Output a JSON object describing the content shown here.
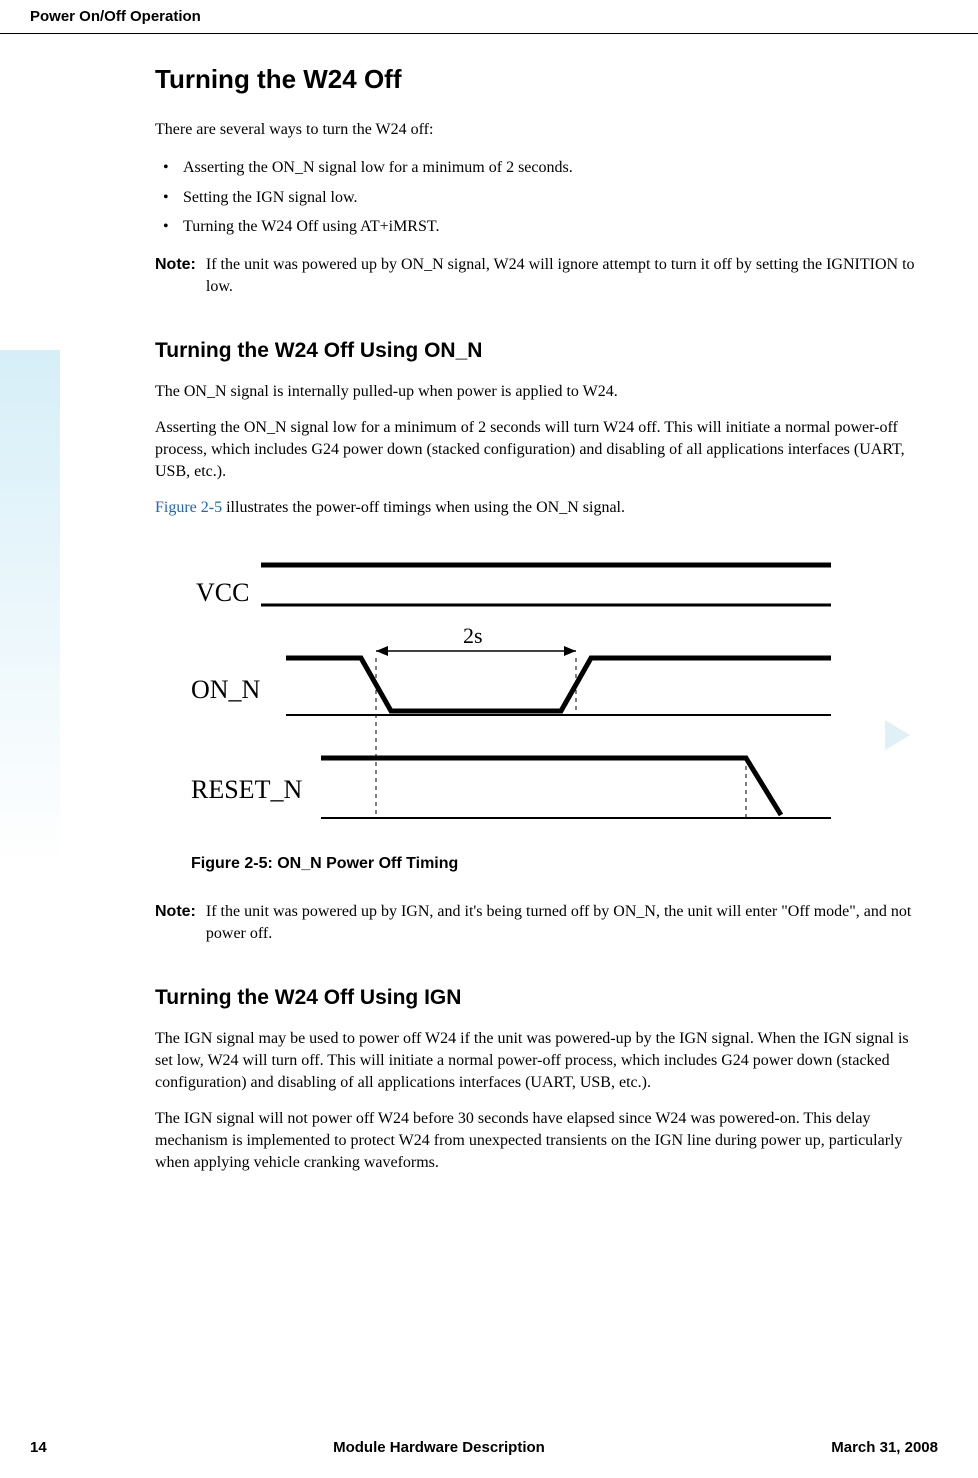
{
  "header": {
    "title": "Power On/Off Operation"
  },
  "section1": {
    "heading": "Turning the W24 Off",
    "intro": "There are several ways to turn the W24 off:",
    "bullets": [
      "Asserting the ON_N signal low for a minimum of 2 seconds.",
      "Setting the IGN signal low.",
      "Turning the W24 Off  using AT+iMRST."
    ],
    "note_label": "Note:",
    "note_text": "If the unit was powered up by ON_N signal, W24 will ignore attempt to turn it off by setting the IGNITION to low."
  },
  "section2": {
    "heading": "Turning the W24 Off Using ON_N",
    "para1": "The ON_N signal is internally pulled-up when power is applied to W24.",
    "para2": "Asserting the ON_N signal low for a minimum of 2 seconds will turn W24 off. This will initiate a normal power-off process, which includes G24 power down (stacked configuration) and disabling of all applications interfaces (UART, USB, etc.).",
    "figref": "Figure 2-5",
    "para3_rest": " illustrates the power-off timings when using the ON_N signal.",
    "figure": {
      "vcc_label": "VCC",
      "onn_label": "ON_N",
      "reset_label": "RESET_N",
      "duration_label": "2s",
      "caption": "Figure 2-5: ON_N Power Off Timing"
    },
    "note2_label": "Note:",
    "note2_text": "If the unit was powered up by IGN, and it's being turned off by ON_N, the unit will enter \"Off mode\", and not power off."
  },
  "section3": {
    "heading": "Turning the W24 Off Using IGN",
    "para1": "The IGN signal may be used to power off W24 if the unit was powered-up by the IGN signal. When the IGN signal is set low, W24 will turn off. This will initiate a normal power-off process, which includes G24 power down (stacked configuration) and disabling of all applications interfaces (UART, USB, etc.).",
    "para2": "The IGN signal will not power off W24 before 30 seconds have elapsed since W24 was powered-on. This delay mechanism is implemented to protect W24 from unexpected transients on the IGN line during power up, particularly when applying vehicle cranking waveforms."
  },
  "footer": {
    "page": "14",
    "doc": "Module Hardware Description",
    "date": "March 31, 2008"
  },
  "chart_data": {
    "type": "timing-diagram",
    "signals": [
      {
        "name": "VCC",
        "trace": "high-constant"
      },
      {
        "name": "ON_N",
        "trace": "high-low-high",
        "low_duration": "2s"
      },
      {
        "name": "RESET_N",
        "trace": "high-then-high-to-low-at-end"
      }
    ],
    "annotations": [
      {
        "label": "2s",
        "between": "ON_N falling edge and rising edge"
      }
    ]
  }
}
